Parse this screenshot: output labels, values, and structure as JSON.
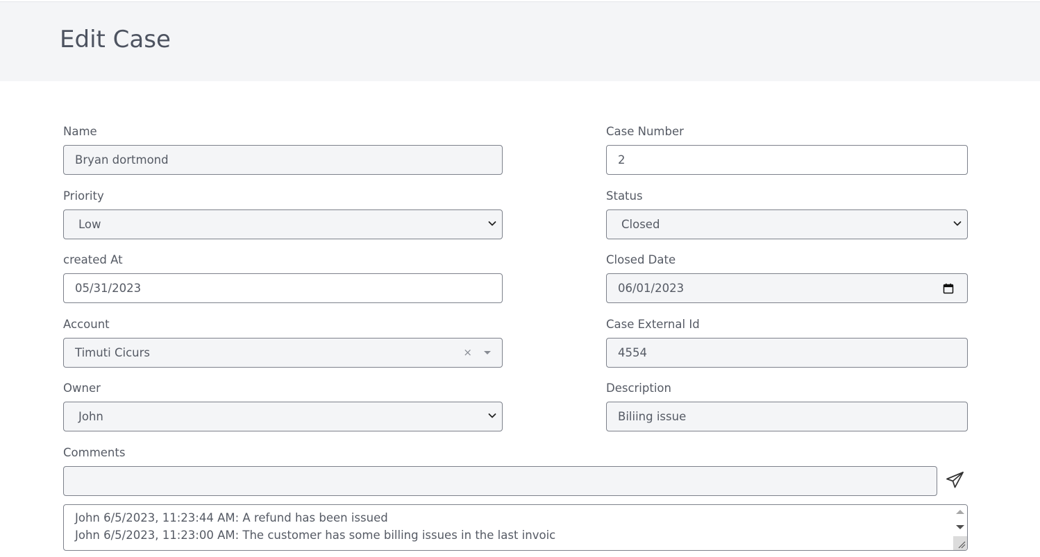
{
  "header": {
    "title": "Edit Case"
  },
  "fields": {
    "name": {
      "label": "Name",
      "value": "Bryan dortmond"
    },
    "case_number": {
      "label": "Case Number",
      "value": "2"
    },
    "priority": {
      "label": "Priority",
      "value": "Low"
    },
    "status": {
      "label": "Status",
      "value": "Closed"
    },
    "created_at": {
      "label": "created At",
      "value": "05/31/2023"
    },
    "closed_date": {
      "label": "Closed Date",
      "value": "06/01/2023"
    },
    "account": {
      "label": "Account",
      "value": "Timuti Cicurs",
      "clear_symbol": "×"
    },
    "case_external_id": {
      "label": "Case External Id",
      "value": "4554"
    },
    "owner": {
      "label": "Owner",
      "value": "John"
    },
    "description": {
      "label": "Description",
      "value": "Biliing issue"
    }
  },
  "comments": {
    "label": "Comments",
    "input_value": "",
    "send_icon": "paper-plane-icon",
    "log": [
      "John 6/5/2023, 11:23:44 AM: A refund has been issued",
      "John 6/5/2023, 11:23:00 AM: The customer has some billing issues in the last invoic"
    ]
  },
  "colors": {
    "header_bg": "#f4f5f7",
    "readonly_bg": "#f4f5f7",
    "border": "#7c808a",
    "text": "#555a64"
  }
}
